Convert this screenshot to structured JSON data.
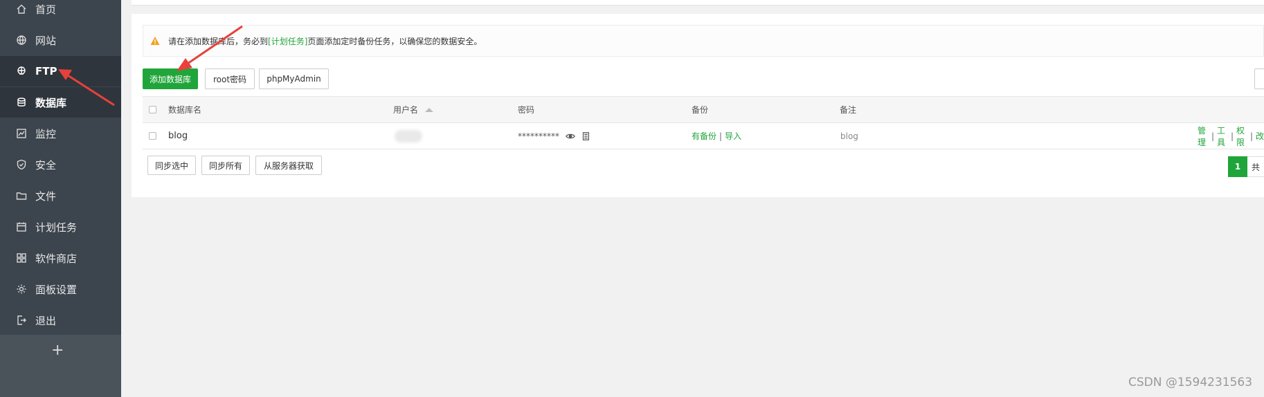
{
  "sidebar": {
    "items": [
      {
        "label": "首页",
        "icon": "home-icon"
      },
      {
        "label": "网站",
        "icon": "globe-icon"
      },
      {
        "label": "FTP",
        "icon": "ftp-icon"
      },
      {
        "label": "数据库",
        "icon": "database-icon"
      },
      {
        "label": "监控",
        "icon": "monitor-icon"
      },
      {
        "label": "安全",
        "icon": "shield-icon"
      },
      {
        "label": "文件",
        "icon": "folder-icon"
      },
      {
        "label": "计划任务",
        "icon": "calendar-icon"
      },
      {
        "label": "软件商店",
        "icon": "apps-icon"
      },
      {
        "label": "面板设置",
        "icon": "gear-icon"
      },
      {
        "label": "退出",
        "icon": "logout-icon"
      }
    ],
    "add_symbol": "+"
  },
  "warning": {
    "prefix": "请在添加数据库后，务必到",
    "link": "[计划任务]",
    "suffix": "页面添加定时备份任务，以确保您的数据安全。"
  },
  "toolbar": {
    "add_db": "添加数据库",
    "root_pwd": "root密码",
    "phpmyadmin": "phpMyAdmin"
  },
  "table": {
    "headers": {
      "name": "数据库名",
      "user": "用户名",
      "password": "密码",
      "backup": "备份",
      "remark": "备注"
    },
    "rows": [
      {
        "name": "blog",
        "password_mask": "**********",
        "backup_status": "有备份",
        "backup_sep": "|",
        "import": "导入",
        "remark": "blog",
        "actions": {
          "manage": "管理",
          "tools": "工具",
          "perm": "权限",
          "more": "改"
        }
      }
    ]
  },
  "bottom": {
    "sync_selected": "同步选中",
    "sync_all": "同步所有",
    "fetch_server": "从服务器获取"
  },
  "pager": {
    "current": "1",
    "total_prefix": "共"
  },
  "watermark": "CSDN @1594231563",
  "colors": {
    "accent": "#20a53a",
    "sidebar": "#3c444d",
    "arrow": "#e8413b"
  }
}
